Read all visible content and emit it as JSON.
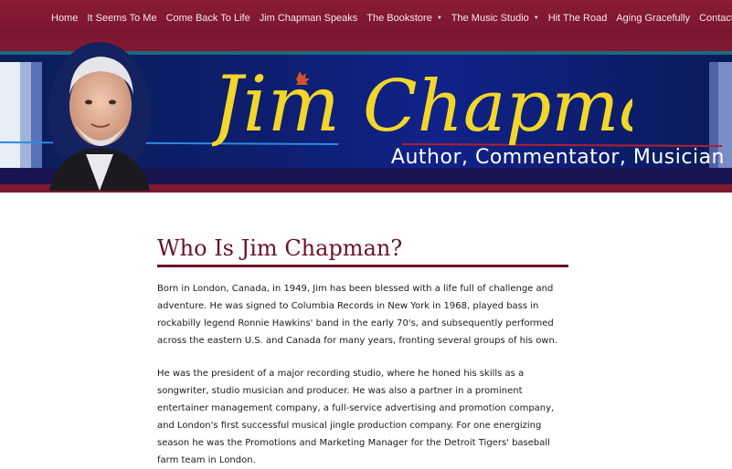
{
  "nav": {
    "items": [
      {
        "label": "Home",
        "dropdown": false
      },
      {
        "label": "It Seems To Me",
        "dropdown": false
      },
      {
        "label": "Come Back To Life",
        "dropdown": false
      },
      {
        "label": "Jim Chapman Speaks",
        "dropdown": false
      },
      {
        "label": "The Bookstore",
        "dropdown": true
      },
      {
        "label": "The Music Studio",
        "dropdown": true
      },
      {
        "label": "Hit The Road",
        "dropdown": false
      },
      {
        "label": "Aging Gracefully",
        "dropdown": false
      },
      {
        "label": "Contact",
        "dropdown": false
      }
    ]
  },
  "banner": {
    "name_part1": "Jim",
    "name_part2": "Chapman",
    "tagline": "Author, Commentator, Musician",
    "colors": {
      "name": "#f2d72a",
      "leaf": "#d1522a",
      "band": "#7d1a32",
      "banner": "#0d1e6e"
    }
  },
  "main": {
    "heading": "Who Is Jim Chapman?",
    "paragraphs": [
      "Born in London, Canada, in 1949, Jim has been blessed with a life full of challenge and adventure. He was signed to Columbia Records in New York in 1968, played bass in rockabilly legend Ronnie Hawkins' band in the early 70's, and subsequently performed across the eastern U.S. and Canada for many years, fronting several groups of his own.",
      "He was the president of a major recording studio, where he honed his skills as a songwriter, studio musician and producer. He was also a partner in a prominent entertainer management company, a full-service advertising and promotion company, and London's first successful musical jingle production company. For one energizing season he was the Promotions and Marketing Manager for the Detroit Tigers' baseball farm team in London."
    ]
  }
}
